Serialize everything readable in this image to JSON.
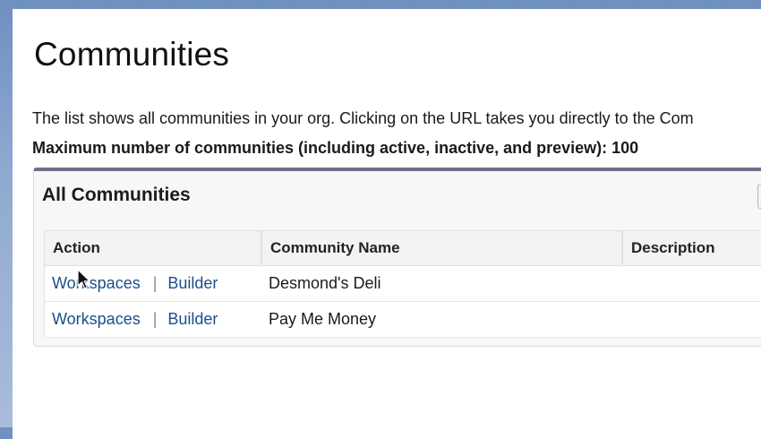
{
  "page": {
    "title": "Communities",
    "description": "The list shows all communities in your org. Clicking on the URL takes you directly to the Com",
    "max_communities": "Maximum number of communities (including active, inactive, and preview): 100"
  },
  "panel": {
    "title": "All Communities",
    "columns": [
      "Action",
      "Community Name",
      "Description"
    ],
    "rows": [
      {
        "workspaces": "Workspaces",
        "separator": "|",
        "builder": "Builder",
        "name": "Desmond's Deli",
        "description": ""
      },
      {
        "workspaces": "Workspaces",
        "separator": "|",
        "builder": "Builder",
        "name": "Pay Me Money",
        "description": ""
      }
    ]
  },
  "colors": {
    "link": "#1a4e8c",
    "panel_top_border": "#6c6f87",
    "background": "#8fa9d0"
  },
  "icons": {
    "cursor": "mouse-pointer-icon"
  }
}
